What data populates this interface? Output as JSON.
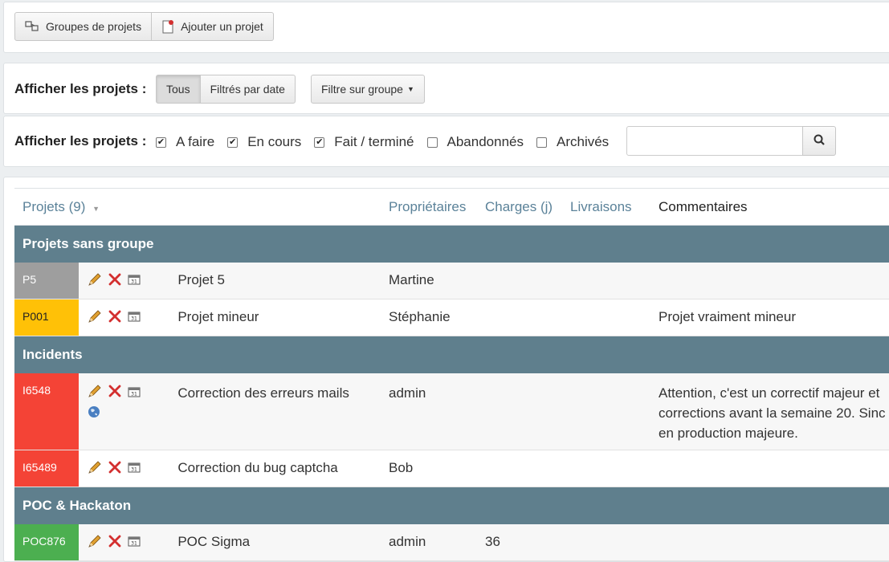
{
  "toolbar": {
    "groups_button": "Groupes de projets",
    "add_button": "Ajouter un projet"
  },
  "filter_bar": {
    "label": "Afficher les projets :",
    "all": "Tous",
    "by_date": "Filtrés par date",
    "group_filter": "Filtre sur groupe"
  },
  "status_bar": {
    "label": "Afficher les projets :",
    "statuses": [
      {
        "label": "A faire",
        "checked": true
      },
      {
        "label": "En cours",
        "checked": true
      },
      {
        "label": "Fait / terminé",
        "checked": true
      },
      {
        "label": "Abandonnés",
        "checked": false
      },
      {
        "label": "Archivés",
        "checked": false
      }
    ],
    "search_value": ""
  },
  "table": {
    "headers": {
      "projects": "Projets (9)",
      "owners": "Propriétaires",
      "charges": "Charges (j)",
      "deliveries": "Livraisons",
      "comments": "Commentaires"
    },
    "groups": [
      {
        "name": "Projets sans groupe",
        "rows": [
          {
            "code": "P5",
            "color": "#9e9e9e",
            "name": "Projet 5",
            "owner": "Martine",
            "charge": "",
            "delivery": "",
            "comment": "",
            "globe": false
          },
          {
            "code": "P001",
            "color": "#ffc107",
            "code_text_color": "#222222",
            "name": "Projet mineur",
            "owner": "Stéphanie",
            "charge": "",
            "delivery": "",
            "comment": "Projet vraiment mineur",
            "globe": false
          }
        ]
      },
      {
        "name": "Incidents",
        "rows": [
          {
            "code": "I6548",
            "color": "#f44336",
            "name": "Correction des erreurs mails",
            "owner": "admin",
            "charge": "",
            "delivery": "",
            "comment_lines": [
              "Attention, c'est un correctif majeur et",
              "corrections avant la semaine 20. Sinc",
              "en production majeure."
            ],
            "globe": true
          },
          {
            "code": "I65489",
            "color": "#f44336",
            "name": "Correction du bug captcha",
            "owner": "Bob",
            "charge": "",
            "delivery": "",
            "comment": "",
            "globe": false
          }
        ]
      },
      {
        "name": "POC & Hackaton",
        "rows": [
          {
            "code": "POC876",
            "color": "#4caf50",
            "name": "POC Sigma",
            "owner": "admin",
            "charge": "36",
            "delivery": "",
            "comment": "",
            "globe": false
          }
        ]
      }
    ]
  },
  "colors": {
    "group_header_bg": "#5f7f8d",
    "link_header": "#5b8299"
  }
}
